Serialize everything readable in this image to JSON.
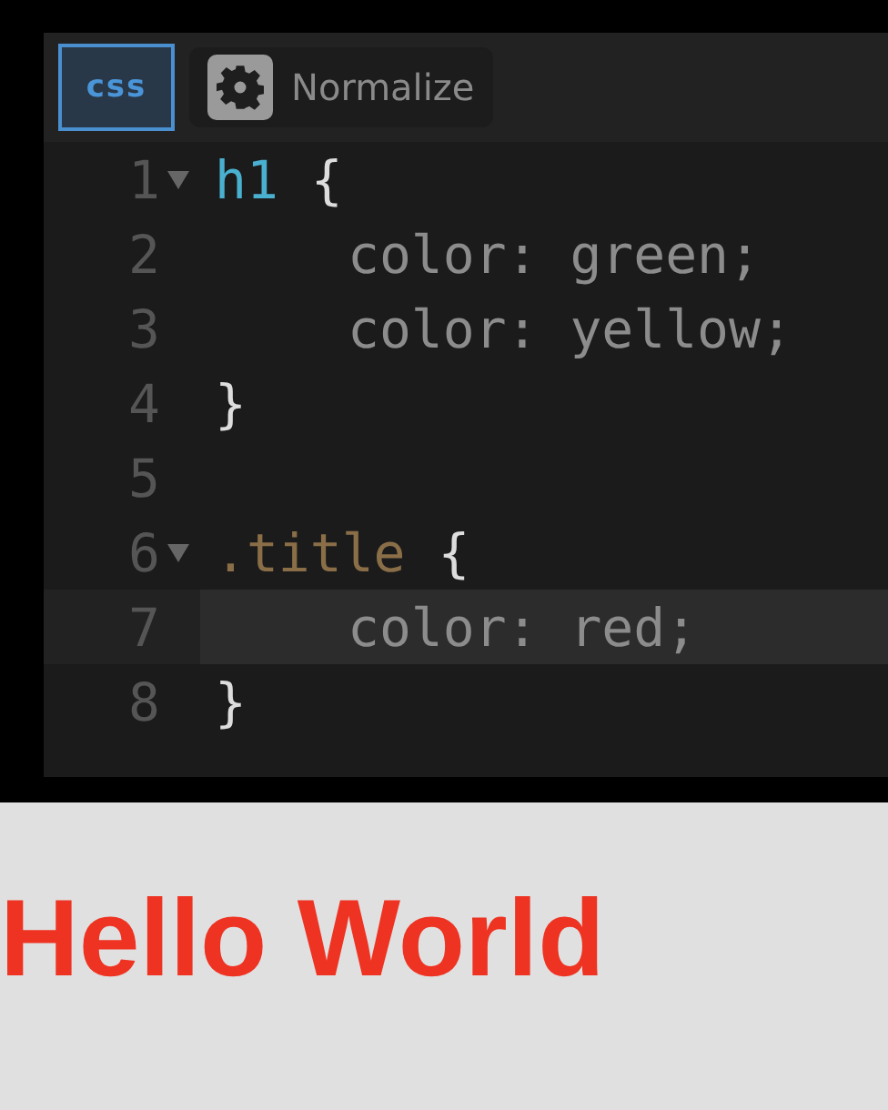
{
  "editor": {
    "language": "css",
    "settings_label": "Normalize",
    "lines": [
      {
        "number": "1",
        "fold": true,
        "active": false,
        "indent": false,
        "tokens": [
          {
            "text": "h1",
            "kind": "tag"
          },
          {
            "text": "{",
            "kind": "brace"
          }
        ]
      },
      {
        "number": "2",
        "fold": false,
        "active": false,
        "indent": true,
        "tokens": [
          {
            "text": "color: green;",
            "kind": "declaration"
          }
        ]
      },
      {
        "number": "3",
        "fold": false,
        "active": false,
        "indent": true,
        "tokens": [
          {
            "text": "color: yellow;",
            "kind": "declaration"
          }
        ]
      },
      {
        "number": "4",
        "fold": false,
        "active": false,
        "indent": false,
        "tokens": [
          {
            "text": "}",
            "kind": "brace"
          }
        ]
      },
      {
        "number": "5",
        "fold": false,
        "active": false
      },
      {
        "number": "6",
        "fold": true,
        "active": false,
        "indent": false,
        "tokens": [
          {
            "text": ".title",
            "kind": "class"
          },
          {
            "text": "{",
            "kind": "brace"
          }
        ]
      },
      {
        "number": "7",
        "fold": false,
        "active": true,
        "indent": true,
        "tokens": [
          {
            "text": "color: red;",
            "kind": "declaration"
          }
        ]
      },
      {
        "number": "8",
        "fold": false,
        "active": false,
        "indent": false,
        "tokens": [
          {
            "text": "}",
            "kind": "brace"
          }
        ]
      }
    ]
  },
  "preview": {
    "heading": "Hello World"
  }
}
